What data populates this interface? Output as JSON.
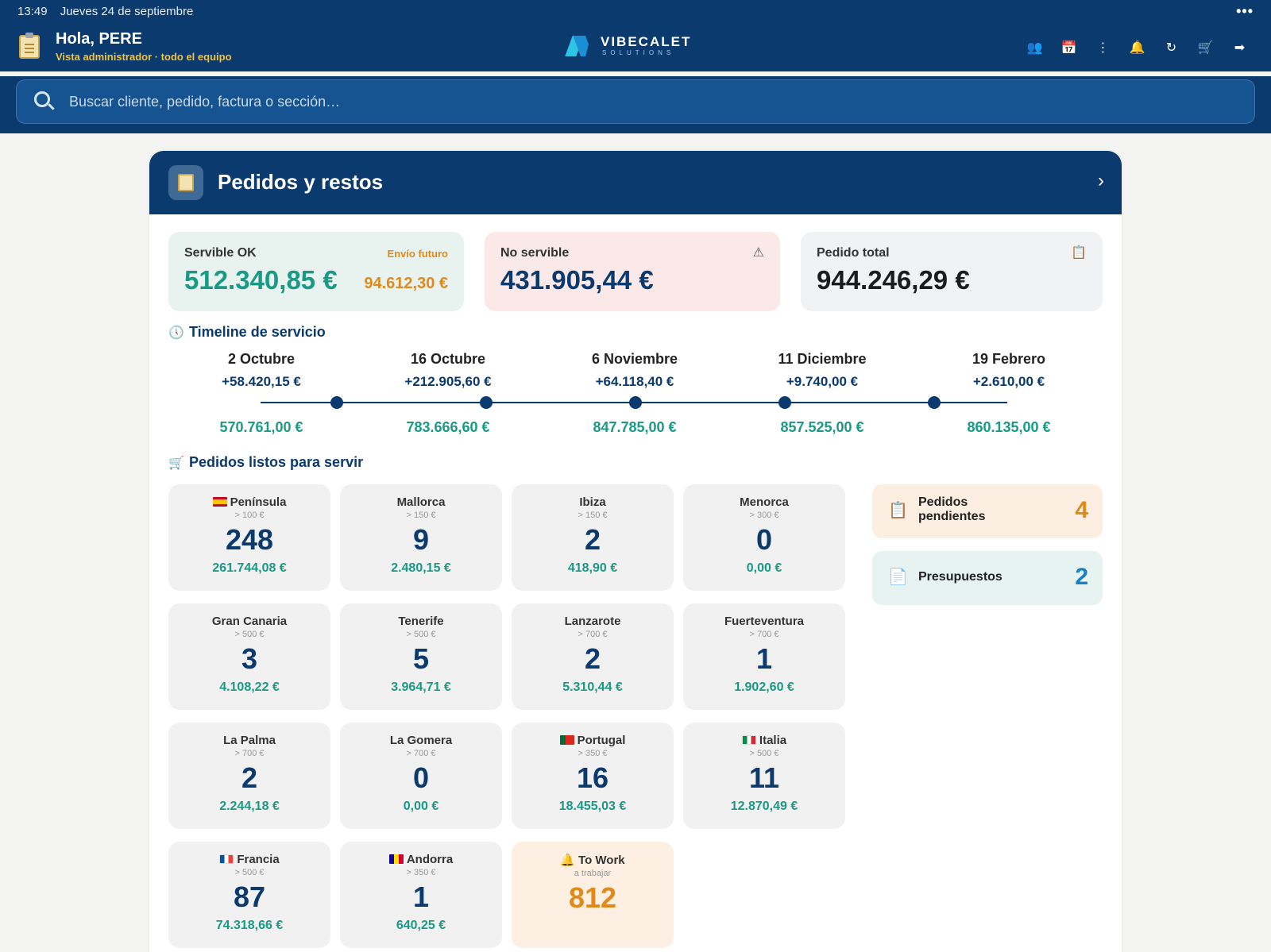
{
  "status": {
    "time": "13:49",
    "date": "Jueves 24 de septiembre",
    "menu_glyph": "•••"
  },
  "header": {
    "greeting": "Hola, PERE",
    "subtitle": "Vista administrador · todo el equipo",
    "brand_name": "VIBECALET",
    "brand_sub": "SOLUTIONS",
    "icons": [
      {
        "name": "users-icon",
        "glyph": "👥"
      },
      {
        "name": "calendar-icon",
        "glyph": "📅"
      },
      {
        "name": "more-vertical-icon",
        "glyph": "⋮"
      },
      {
        "name": "bell-icon",
        "glyph": "🔔"
      },
      {
        "name": "refresh-icon",
        "glyph": "↻"
      },
      {
        "name": "cart-icon",
        "glyph": "🛒"
      },
      {
        "name": "logout-icon",
        "glyph": "➡"
      }
    ]
  },
  "search": {
    "placeholder": "Buscar cliente, pedido, factura o sección…"
  },
  "panel": {
    "title": "Pedidos y restos",
    "chevron": "›"
  },
  "summary": {
    "ok": {
      "label": "Servible OK",
      "value": "512.340,85 €",
      "future_label": "Envío futuro",
      "future_value": "94.612,30 €"
    },
    "no": {
      "label": "No servible",
      "value": "431.905,44 €",
      "icon": "⚠"
    },
    "total": {
      "label": "Pedido total",
      "value": "944.246,29 €",
      "icon": "📋"
    }
  },
  "timeline": {
    "title": "Timeline de servicio",
    "icon": "🕔",
    "points": [
      {
        "date": "2 Octubre",
        "delta": "+58.420,15 €",
        "total": "570.761,00 €"
      },
      {
        "date": "16 Octubre",
        "delta": "+212.905,60 €",
        "total": "783.666,60 €"
      },
      {
        "date": "6 Noviembre",
        "delta": "+64.118,40 €",
        "total": "847.785,00 €"
      },
      {
        "date": "11 Diciembre",
        "delta": "+9.740,00 €",
        "total": "857.525,00 €"
      },
      {
        "date": "19 Febrero",
        "delta": "+2.610,00 €",
        "total": "860.135,00 €"
      }
    ]
  },
  "ready": {
    "title": "Pedidos listos para servir",
    "icon": "🛒",
    "tiles": [
      {
        "name": "Península",
        "flag": "es",
        "min": "> 100 €",
        "count": "248",
        "amount": "261.744,08 €"
      },
      {
        "name": "Mallorca",
        "flag": "",
        "min": "> 150 €",
        "count": "9",
        "amount": "2.480,15 €"
      },
      {
        "name": "Ibiza",
        "flag": "",
        "min": "> 150 €",
        "count": "2",
        "amount": "418,90 €"
      },
      {
        "name": "Menorca",
        "flag": "",
        "min": "> 300 €",
        "count": "0",
        "amount": "0,00 €"
      },
      {
        "name": "Gran Canaria",
        "flag": "",
        "min": "> 500 €",
        "count": "3",
        "amount": "4.108,22 €"
      },
      {
        "name": "Tenerife",
        "flag": "",
        "min": "> 500 €",
        "count": "5",
        "amount": "3.964,71 €"
      },
      {
        "name": "Lanzarote",
        "flag": "",
        "min": "> 700 €",
        "count": "2",
        "amount": "5.310,44 €"
      },
      {
        "name": "Fuerteventura",
        "flag": "",
        "min": "> 700 €",
        "count": "1",
        "amount": "1.902,60 €"
      },
      {
        "name": "La Palma",
        "flag": "",
        "min": "> 700 €",
        "count": "2",
        "amount": "2.244,18 €"
      },
      {
        "name": "La Gomera",
        "flag": "",
        "min": "> 700 €",
        "count": "0",
        "amount": "0,00 €"
      },
      {
        "name": "Portugal",
        "flag": "pt",
        "min": "> 350 €",
        "count": "16",
        "amount": "18.455,03 €"
      },
      {
        "name": "Italia",
        "flag": "it",
        "min": "> 500 €",
        "count": "11",
        "amount": "12.870,49 €"
      },
      {
        "name": "Francia",
        "flag": "fr",
        "min": "> 500 €",
        "count": "87",
        "amount": "74.318,66 €"
      },
      {
        "name": "Andorra",
        "flag": "ad",
        "min": "> 350 €",
        "count": "1",
        "amount": "640,25 €"
      },
      {
        "name": "To Work",
        "flag": "bell",
        "min": "a trabajar",
        "count": "812",
        "amount": ""
      }
    ]
  },
  "side": {
    "pending": {
      "label_line1": "Pedidos",
      "label_line2": "pendientes",
      "count": "4",
      "icon": "📋",
      "color": "#e08a1c"
    },
    "budgets": {
      "label": "Presupuestos",
      "count": "2",
      "icon": "📄",
      "color": "#1a7fc4"
    }
  },
  "colors": {
    "navy": "#0b3a6e",
    "teal": "#1a9a84",
    "orange": "#e08a1c"
  }
}
